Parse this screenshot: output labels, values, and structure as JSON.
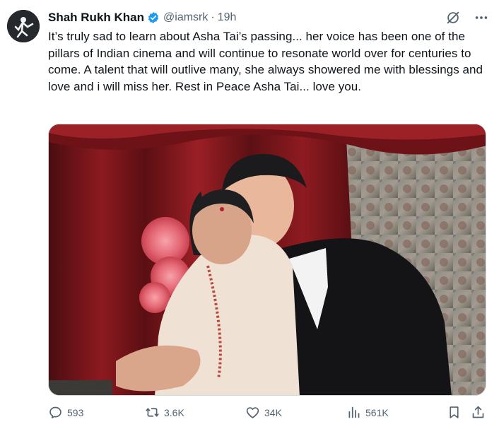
{
  "tweet": {
    "display_name": "Shah Rukh Khan",
    "handle": "@iamsrk",
    "separator": "·",
    "time": "19h",
    "text": "It’s truly sad to learn about Asha Tai’s passing... her voice has been one of the pillars of Indian cinema and will continue to resonate world over for centuries to come. A talent that will outlive many, she always showered me with blessings and love and i will miss her. Rest in Peace Asha Tai... love you."
  },
  "header_icons": [
    "grok-icon",
    "more-icon"
  ],
  "actions": {
    "replies": "593",
    "reposts": "3.6K",
    "likes": "34K",
    "views": "561K"
  },
  "colors": {
    "text_primary": "#0f1419",
    "text_secondary": "#536471",
    "verified_blue": "#1d9bf0",
    "border": "#cfd9de"
  }
}
